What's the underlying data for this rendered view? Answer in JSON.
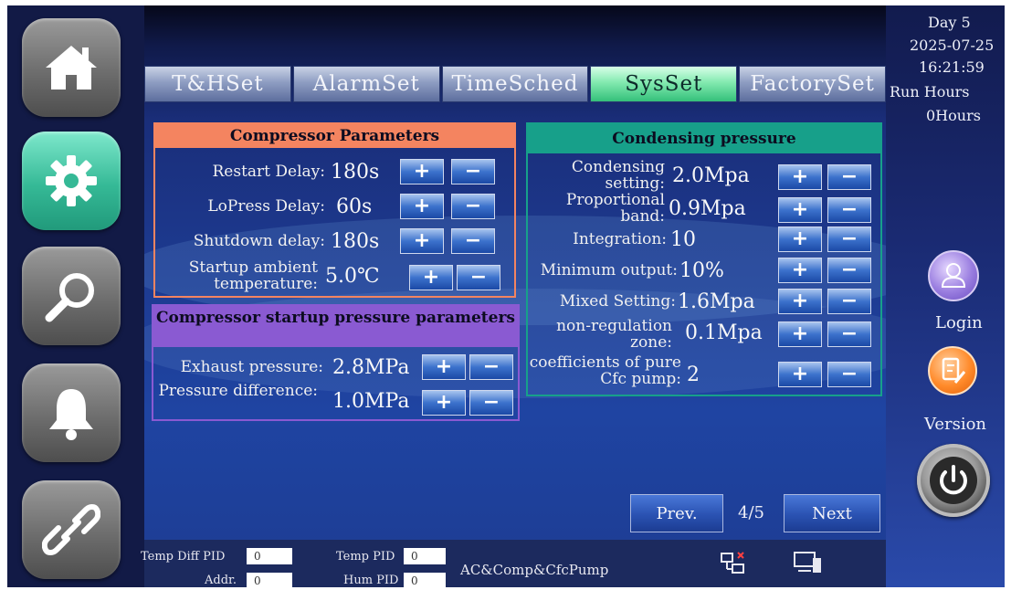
{
  "nav": {
    "items": [
      {
        "icon": "home-icon"
      },
      {
        "icon": "gear-icon",
        "active": true
      },
      {
        "icon": "search-icon"
      },
      {
        "icon": "bell-icon"
      },
      {
        "icon": "link-icon"
      }
    ]
  },
  "tabs": [
    "T&HSet",
    "AlarmSet",
    "TimeSched",
    "SysSet",
    "FactorySet"
  ],
  "active_tab": "SysSet",
  "compressor": {
    "title": "Compressor Parameters",
    "rows": [
      {
        "label": "Restart Delay:",
        "value": "180s"
      },
      {
        "label": "LoPress Delay:",
        "value": "60s"
      },
      {
        "label": "Shutdown delay:",
        "value": "180s"
      },
      {
        "label": "Startup ambient temperature:",
        "value": "5.0℃"
      }
    ]
  },
  "startup_pressure": {
    "title": "Compressor startup pressure parameters",
    "rows": [
      {
        "label": "Exhaust pressure:",
        "value": "2.8MPa"
      },
      {
        "label": "Pressure difference:",
        "value": "1.0MPa"
      }
    ]
  },
  "condensing": {
    "title": "Condensing pressure",
    "rows": [
      {
        "label": "Condensing setting:",
        "value": "2.0Mpa"
      },
      {
        "label": "Proportional band:",
        "value": "0.9Mpa"
      },
      {
        "label": "Integration:",
        "value": "10"
      },
      {
        "label": "Minimum output:",
        "value": "10%"
      },
      {
        "label": "Mixed Setting:",
        "value": "1.6Mpa"
      },
      {
        "label": "non-regulation zone:",
        "value": "0.1Mpa"
      },
      {
        "label": "coefficients of pure Cfc pump:",
        "value": "2"
      }
    ]
  },
  "buttons": {
    "plus": "+",
    "minus": "−"
  },
  "pager": {
    "prev": "Prev.",
    "page": "4/5",
    "next": "Next"
  },
  "status": {
    "day": "Day  5",
    "date": "2025-07-25",
    "time": "16:21:59",
    "run_hours_label": "Run Hours",
    "run_hours_value": "0Hours",
    "login": "Login",
    "version": "Version"
  },
  "footer": {
    "temp_diff_pid_label": "Temp Diff PID",
    "temp_diff_pid_value": "0",
    "addr_label": "Addr.",
    "addr_value": "0",
    "temp_pid_label": "Temp PID",
    "temp_pid_value": "0",
    "hum_pid_label": "Hum PID",
    "hum_pid_value": "0",
    "mode": "AC&Comp&CfcPump"
  },
  "colors": {
    "compressor_panel": "#f48460",
    "startup_panel": "#8a5ad2",
    "condensing_panel": "#17a08a",
    "active_nav": "#35b996"
  }
}
